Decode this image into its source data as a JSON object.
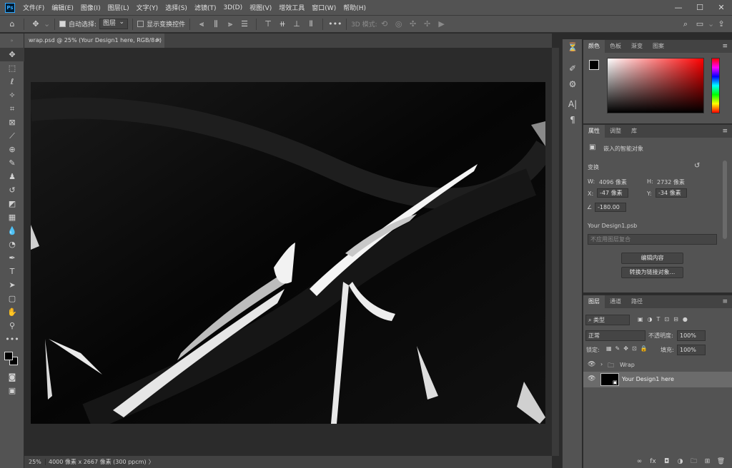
{
  "app": {
    "logo": "Ps"
  },
  "menu": [
    "文件(F)",
    "编辑(E)",
    "图像(I)",
    "图层(L)",
    "文字(Y)",
    "选择(S)",
    "滤镜(T)",
    "3D(D)",
    "视图(V)",
    "增效工具",
    "窗口(W)",
    "帮助(H)"
  ],
  "window_controls": {
    "minimize": "—",
    "maximize": "☐",
    "close": "✕"
  },
  "options": {
    "auto_select_label": "自动选择:",
    "auto_select_value": "图层",
    "show_transform_label": "显示变换控件",
    "more": "•••",
    "mode_3d_label": "3D 模式:"
  },
  "document": {
    "tab_title": "wrap.psd @ 25% (Your Design1 here, RGB/8#)",
    "close": "×",
    "zoom": "25%",
    "info": "4000 像素 x 2667 像素 (300 ppcm)",
    "info_arrow": "〉"
  },
  "color_panel": {
    "tabs": [
      "颜色",
      "色板",
      "渐变",
      "图案"
    ],
    "active": 0,
    "fg": "#000000",
    "bg": "#000000"
  },
  "properties": {
    "tabs": [
      "属性",
      "调整",
      "库"
    ],
    "active": 0,
    "kind": "嵌入的智能对象",
    "transform_label": "变换",
    "w_label": "W:",
    "w_value": "4096 像素",
    "h_label": "H:",
    "h_value": "2732 像素",
    "x_label": "X:",
    "x_value": "-47 像素",
    "y_label": "Y:",
    "y_value": "-34 像素",
    "angle_value": "-180.00",
    "file_name": "Your Design1.psb",
    "comp_placeholder": "不应用图层复合",
    "edit_button": "编辑内容",
    "convert_button": "转换为链接对象..."
  },
  "layers": {
    "tabs": [
      "图层",
      "通道",
      "路径"
    ],
    "active": 0,
    "filter_label": "类型",
    "blend_mode": "正常",
    "opacity_label": "不透明度:",
    "opacity_value": "100%",
    "lock_label": "锁定:",
    "fill_label": "填充:",
    "fill_value": "100%",
    "items": [
      {
        "name": "Wrap",
        "type": "group"
      },
      {
        "name": "Your Design1 here",
        "type": "smart-object",
        "selected": true
      }
    ]
  }
}
